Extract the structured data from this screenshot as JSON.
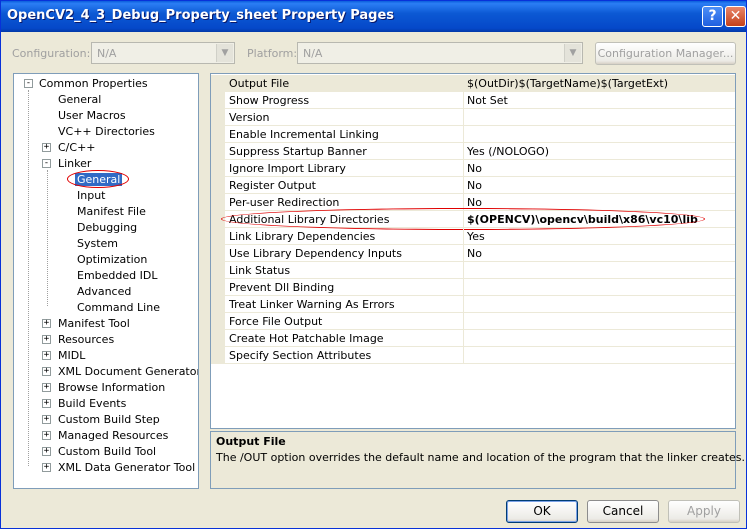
{
  "window": {
    "title": "OpenCV2_4_3_Debug_Property_sheet Property Pages",
    "help_glyph": "?",
    "close_glyph": "✕"
  },
  "config_bar": {
    "configuration_label": "Configuration:",
    "configuration_value": "N/A",
    "platform_label": "Platform:",
    "platform_value": "N/A",
    "manager_button": "Configuration Manager..."
  },
  "tree": {
    "root": "Common Properties",
    "items": [
      {
        "label": "General"
      },
      {
        "label": "User Macros"
      },
      {
        "label": "VC++ Directories"
      },
      {
        "label": "C/C++"
      },
      {
        "label": "Linker"
      },
      {
        "label": "General"
      },
      {
        "label": "Input"
      },
      {
        "label": "Manifest File"
      },
      {
        "label": "Debugging"
      },
      {
        "label": "System"
      },
      {
        "label": "Optimization"
      },
      {
        "label": "Embedded IDL"
      },
      {
        "label": "Advanced"
      },
      {
        "label": "Command Line"
      },
      {
        "label": "Manifest Tool"
      },
      {
        "label": "Resources"
      },
      {
        "label": "MIDL"
      },
      {
        "label": "XML Document Generator"
      },
      {
        "label": "Browse Information"
      },
      {
        "label": "Build Events"
      },
      {
        "label": "Custom Build Step"
      },
      {
        "label": "Managed Resources"
      },
      {
        "label": "Custom Build Tool"
      },
      {
        "label": "XML Data Generator Tool"
      }
    ],
    "selected": "General"
  },
  "properties": [
    {
      "name": "Output File",
      "value": "$(OutDir)$(TargetName)$(TargetExt)"
    },
    {
      "name": "Show Progress",
      "value": "Not Set"
    },
    {
      "name": "Version",
      "value": ""
    },
    {
      "name": "Enable Incremental Linking",
      "value": ""
    },
    {
      "name": "Suppress Startup Banner",
      "value": "Yes (/NOLOGO)"
    },
    {
      "name": "Ignore Import Library",
      "value": "No"
    },
    {
      "name": "Register Output",
      "value": "No"
    },
    {
      "name": "Per-user Redirection",
      "value": "No"
    },
    {
      "name": "Additional Library Directories",
      "value": "$(OPENCV)\\opencv\\build\\x86\\vc10\\lib"
    },
    {
      "name": "Link Library Dependencies",
      "value": "Yes"
    },
    {
      "name": "Use Library Dependency Inputs",
      "value": "No"
    },
    {
      "name": "Link Status",
      "value": ""
    },
    {
      "name": "Prevent Dll Binding",
      "value": ""
    },
    {
      "name": "Treat Linker Warning As Errors",
      "value": ""
    },
    {
      "name": "Force File Output",
      "value": ""
    },
    {
      "name": "Create Hot Patchable Image",
      "value": ""
    },
    {
      "name": "Specify Section Attributes",
      "value": ""
    }
  ],
  "description": {
    "title": "Output File",
    "text": "The /OUT option overrides the default name and location of the program that the linker creates."
  },
  "buttons": {
    "ok": "OK",
    "cancel": "Cancel",
    "apply": "Apply"
  },
  "colors": {
    "selection": "#316ac5",
    "annotation": "#e00000"
  }
}
